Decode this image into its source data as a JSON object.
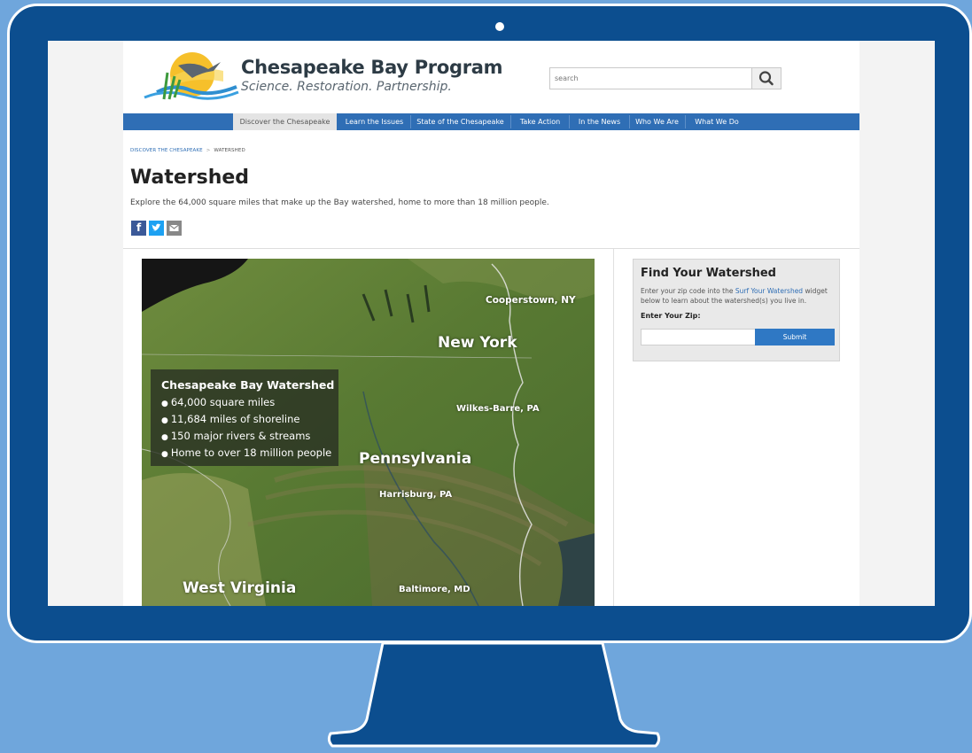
{
  "site": {
    "title": "Chesapeake Bay Program",
    "tagline": "Science. Restoration. Partnership."
  },
  "search": {
    "placeholder": "search",
    "icon": "search-icon"
  },
  "nav": {
    "items": [
      {
        "label": "Discover the Chesapeake",
        "active": true
      },
      {
        "label": "Learn the Issues"
      },
      {
        "label": "State of the Chesapeake"
      },
      {
        "label": "Take Action"
      },
      {
        "label": "In the News"
      },
      {
        "label": "Who We Are"
      },
      {
        "label": "What We Do"
      }
    ]
  },
  "breadcrumb": {
    "parent": "DISCOVER THE CHESAPEAKE",
    "separator": ">",
    "current": "WATERSHED"
  },
  "page": {
    "title": "Watershed",
    "subtitle": "Explore the 64,000 square miles that make up the Bay watershed, home to more than 18 million people."
  },
  "social": {
    "facebook": "f",
    "twitter": "twitter-icon",
    "email": "email-icon"
  },
  "map": {
    "labels": {
      "cooperstown": "Cooperstown, NY",
      "new_york": "New York",
      "wilkes_barre": "Wilkes-Barre, PA",
      "pennsylvania": "Pennsylvania",
      "harrisburg": "Harrisburg, PA",
      "west_virginia": "West Virginia",
      "baltimore": "Baltimore, MD"
    },
    "legend": {
      "title": "Chesapeake Bay Watershed",
      "items": [
        "64,000 square miles",
        "11,684 miles of shoreline",
        "150 major rivers & streams",
        "Home to over 18 million people"
      ]
    }
  },
  "widget": {
    "title": "Find Your Watershed",
    "desc_before": "Enter your zip code into the ",
    "desc_link": "Surf Your Watershed",
    "desc_after": " widget below to learn about the watershed(s) you live in.",
    "zip_label": "Enter Your Zip:",
    "zip_value": "",
    "submit_label": "Submit"
  },
  "colors": {
    "monitor": "#0c4e8f",
    "background": "#6fa6dc",
    "nav": "#2f6eb5",
    "facebook": "#3b5998",
    "twitter": "#1da1f2",
    "email": "#888888",
    "submit": "#2f78c4"
  }
}
